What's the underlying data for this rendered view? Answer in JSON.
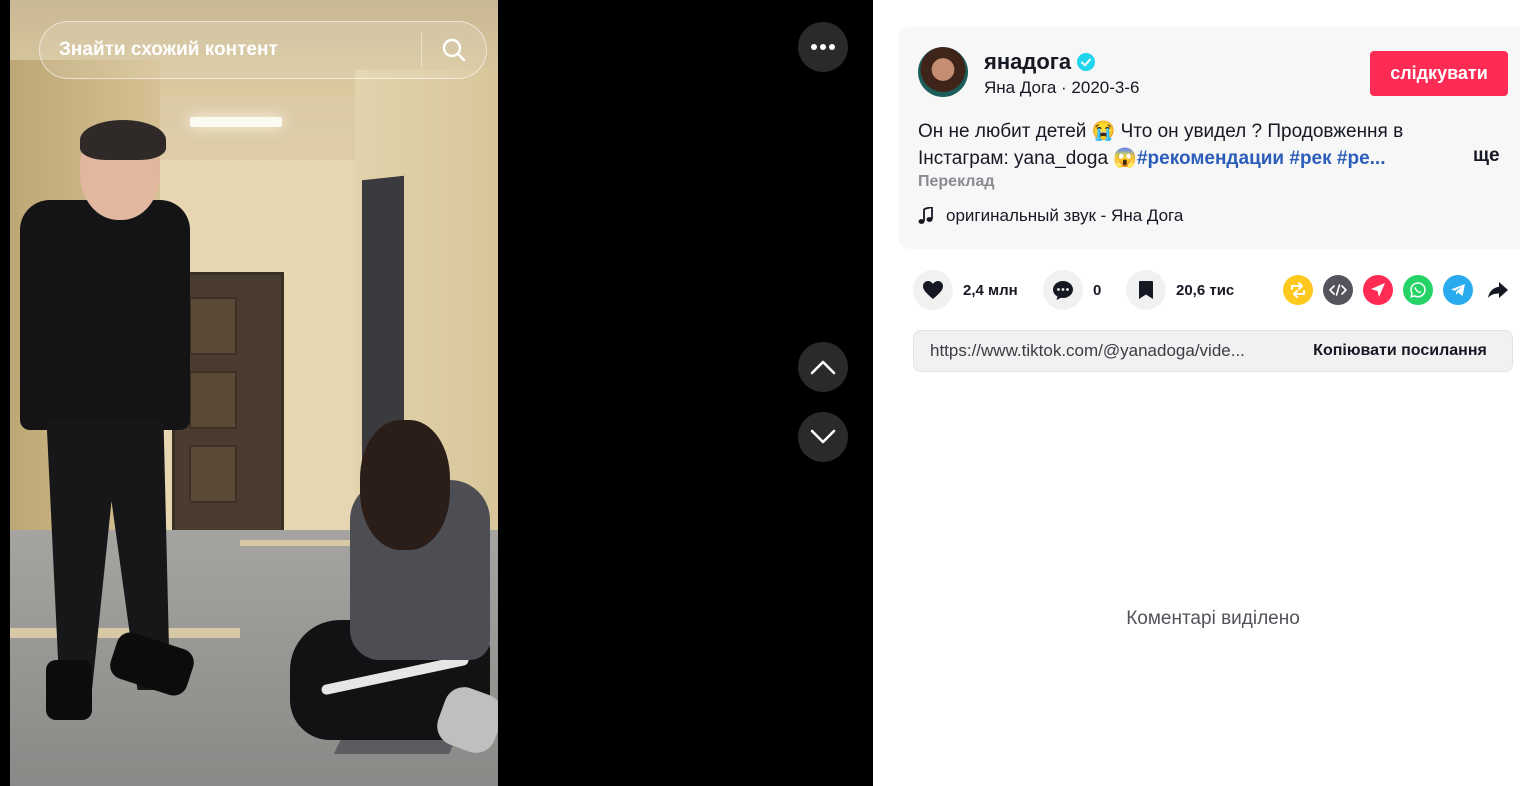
{
  "video": {
    "search_text": "Знайти схожий контент"
  },
  "author": {
    "username": "янадога",
    "display_name": "Яна Дога",
    "date": "2020-3-6",
    "separator": " · ",
    "follow_label": "слідкувати"
  },
  "description": {
    "text_part1": "Он не любит детей 😭 Что он увидел ? Продовження в Інстаграм: yana_doga 😱",
    "tags": "#рекомендации #рек #ре...",
    "more_label": "ще",
    "translate_label": "Переклад"
  },
  "music": {
    "label": "оригинальный звук - Яна Дога"
  },
  "stats": {
    "likes": "2,4 млн",
    "comments": "0",
    "saves": "20,6 тис"
  },
  "share": {
    "icons": [
      "repost-icon",
      "embed-icon",
      "send-icon",
      "whatsapp-icon",
      "telegram-icon",
      "share-arrow-icon"
    ]
  },
  "link": {
    "url": "https://www.tiktok.com/@yanadoga/vide...",
    "copy_label": "Копіювати посилання"
  },
  "comments": {
    "disabled_text": "Коментарі виділено"
  },
  "colors": {
    "accent": "#fe2c55",
    "hashtag": "#2b5db9"
  }
}
